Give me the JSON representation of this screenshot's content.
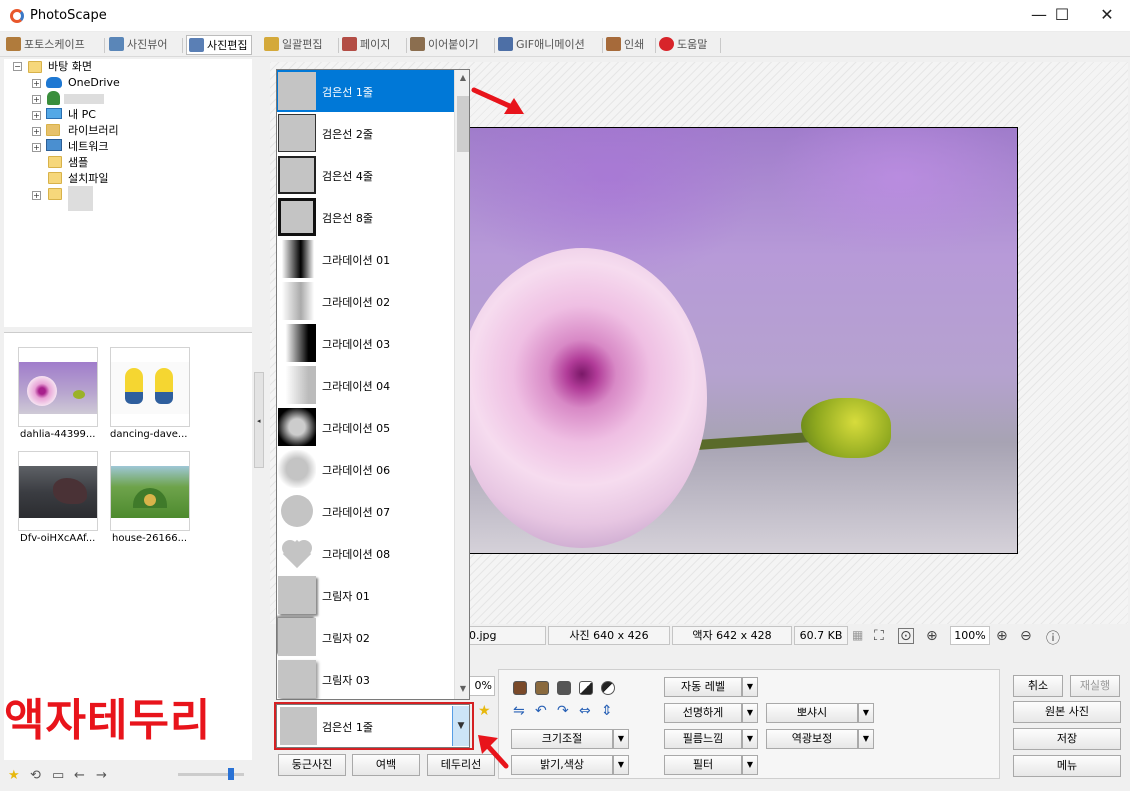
{
  "window": {
    "title": "PhotoScape",
    "minimize": "—",
    "maximize": "☐",
    "close": "✕"
  },
  "menu": [
    {
      "label": "포토스케이프",
      "color": "#b07b3c"
    },
    {
      "label": "사진뷰어",
      "color": "#5a86b8"
    },
    {
      "label": "사진편집",
      "color": "#5a7fb5",
      "active": true
    },
    {
      "label": "일괄편집",
      "color": "#d4a93a"
    },
    {
      "label": "페이지",
      "color": "#b34d45"
    },
    {
      "label": "이어붙이기",
      "color": "#8b6e4f"
    },
    {
      "label": "GIF애니메이션",
      "color": "#4d6fa6"
    },
    {
      "label": "인쇄",
      "color": "#a66a3a"
    },
    {
      "label": "도움말",
      "color": "#d8242a"
    }
  ],
  "tree": {
    "root": "바탕 화면",
    "items": [
      "OneDrive",
      "내 PC",
      "라이브러리",
      "네트워크",
      "샘플",
      "설치파일"
    ]
  },
  "thumbnails": [
    {
      "label": "dahlia-44399..."
    },
    {
      "label": "dancing-dave..."
    },
    {
      "label": "Dfv-oiHXcAAf..."
    },
    {
      "label": "house-26166..."
    }
  ],
  "frame_list": {
    "items": [
      {
        "label": "검은선 1줄",
        "selected": true
      },
      {
        "label": "검은선 2줄"
      },
      {
        "label": "검은선 4줄"
      },
      {
        "label": "검은선 8줄"
      },
      {
        "label": "그라데이션 01"
      },
      {
        "label": "그라데이션 02"
      },
      {
        "label": "그라데이션 03"
      },
      {
        "label": "그라데이션 04"
      },
      {
        "label": "그라데이션 05"
      },
      {
        "label": "그라데이션 06"
      },
      {
        "label": "그라데이션 07"
      },
      {
        "label": "그라데이션 08"
      },
      {
        "label": "그림자 01"
      },
      {
        "label": "그림자 02"
      },
      {
        "label": "그림자 03"
      }
    ],
    "selected_value": "검은선 1줄"
  },
  "status": {
    "filename": "40.jpg",
    "photo_size": "사진 640 x 426",
    "frame_size": "액자 642 x 428",
    "file_size": "60.7 KB",
    "zoom": "100%"
  },
  "zoom_box": "0%",
  "tools": {
    "auto_level": "자동 레벨",
    "sharpen": "선명하게",
    "bloom": "뽀샤시",
    "resize": "크기조절",
    "film": "필름느낌",
    "backlight": "역광보정",
    "brightness": "밝기,색상",
    "filter": "필터"
  },
  "bottom_buttons": {
    "round": "둥근사진",
    "margin": "여백",
    "border": "테두리선"
  },
  "side_buttons": {
    "undo": "취소",
    "redo": "재실행",
    "original": "원본 사진",
    "save": "저장",
    "menu": "메뉴"
  },
  "annotation_text": "액자테두리",
  "colors": {
    "accent": "#0078d7",
    "annotation": "#e8141b"
  }
}
